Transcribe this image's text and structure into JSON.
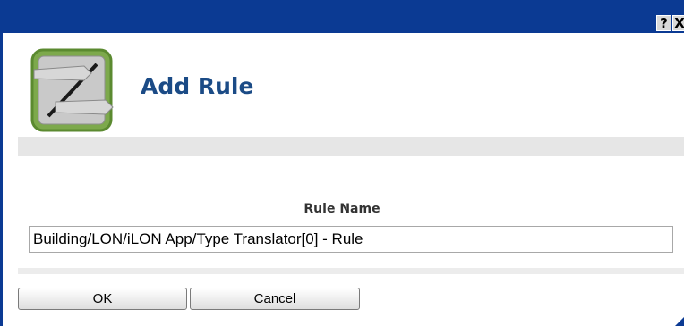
{
  "window": {
    "help_button_label": "?",
    "close_button_label": "X"
  },
  "dialog": {
    "title": "Add Rule",
    "icon": "rule-diagonal-icon"
  },
  "form": {
    "rule_name_label": "Rule Name",
    "rule_name_value": "Building/LON/iLON App/Type Translator[0] - Rule"
  },
  "buttons": {
    "ok_label": "OK",
    "cancel_label": "Cancel"
  },
  "colors": {
    "titlebar": "#0b3a93",
    "title_text": "#1b4b86",
    "icon_border": "#6e9c3e"
  }
}
